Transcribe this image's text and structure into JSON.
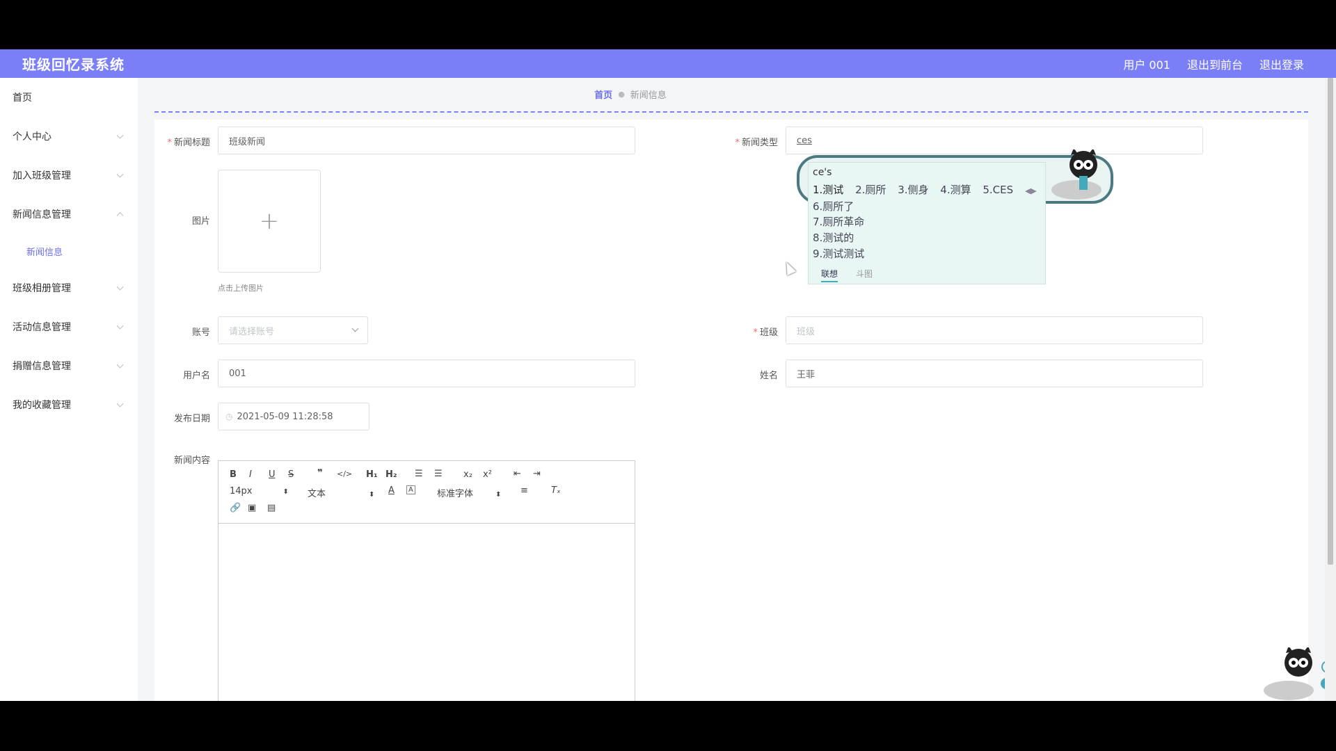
{
  "header": {
    "title": "班级回忆录系统",
    "user": "用户 001",
    "to_front": "退出到前台",
    "logout": "退出登录"
  },
  "sidebar": {
    "items": [
      {
        "label": "首页"
      },
      {
        "label": "个人中心"
      },
      {
        "label": "加入班级管理"
      },
      {
        "label": "新闻信息管理"
      },
      {
        "label": "新闻信息"
      },
      {
        "label": "班级相册管理"
      },
      {
        "label": "活动信息管理"
      },
      {
        "label": "捐赠信息管理"
      },
      {
        "label": "我的收藏管理"
      }
    ]
  },
  "breadcrumb": {
    "home": "首页",
    "current": "新闻信息"
  },
  "form": {
    "title_label": "新闻标题",
    "title_value": "班级新闻",
    "type_label": "新闻类型",
    "type_value": "ces",
    "image_label": "图片",
    "upload_hint": "点击上传图片",
    "account_label": "账号",
    "account_placeholder": "请选择账号",
    "class_label": "班级",
    "class_placeholder": "班级",
    "username_label": "用户名",
    "username_value": "001",
    "name_label": "姓名",
    "name_value": "王菲",
    "date_label": "发布日期",
    "date_value": "2021-05-09 11:28:58",
    "content_label": "新闻内容"
  },
  "editor": {
    "font_size": "14px",
    "block_type": "文本",
    "font_family": "标准字体"
  },
  "ime": {
    "pinyin": "ce's",
    "row1": [
      "1.测试",
      "2.厕所",
      "3.侧身",
      "4.测算",
      "5.CES"
    ],
    "more": [
      "6.厕所了",
      "7.厕所革命",
      "8.测试的",
      "9.测试测试"
    ],
    "tab_active": "联想",
    "tab_other": "斗图"
  }
}
